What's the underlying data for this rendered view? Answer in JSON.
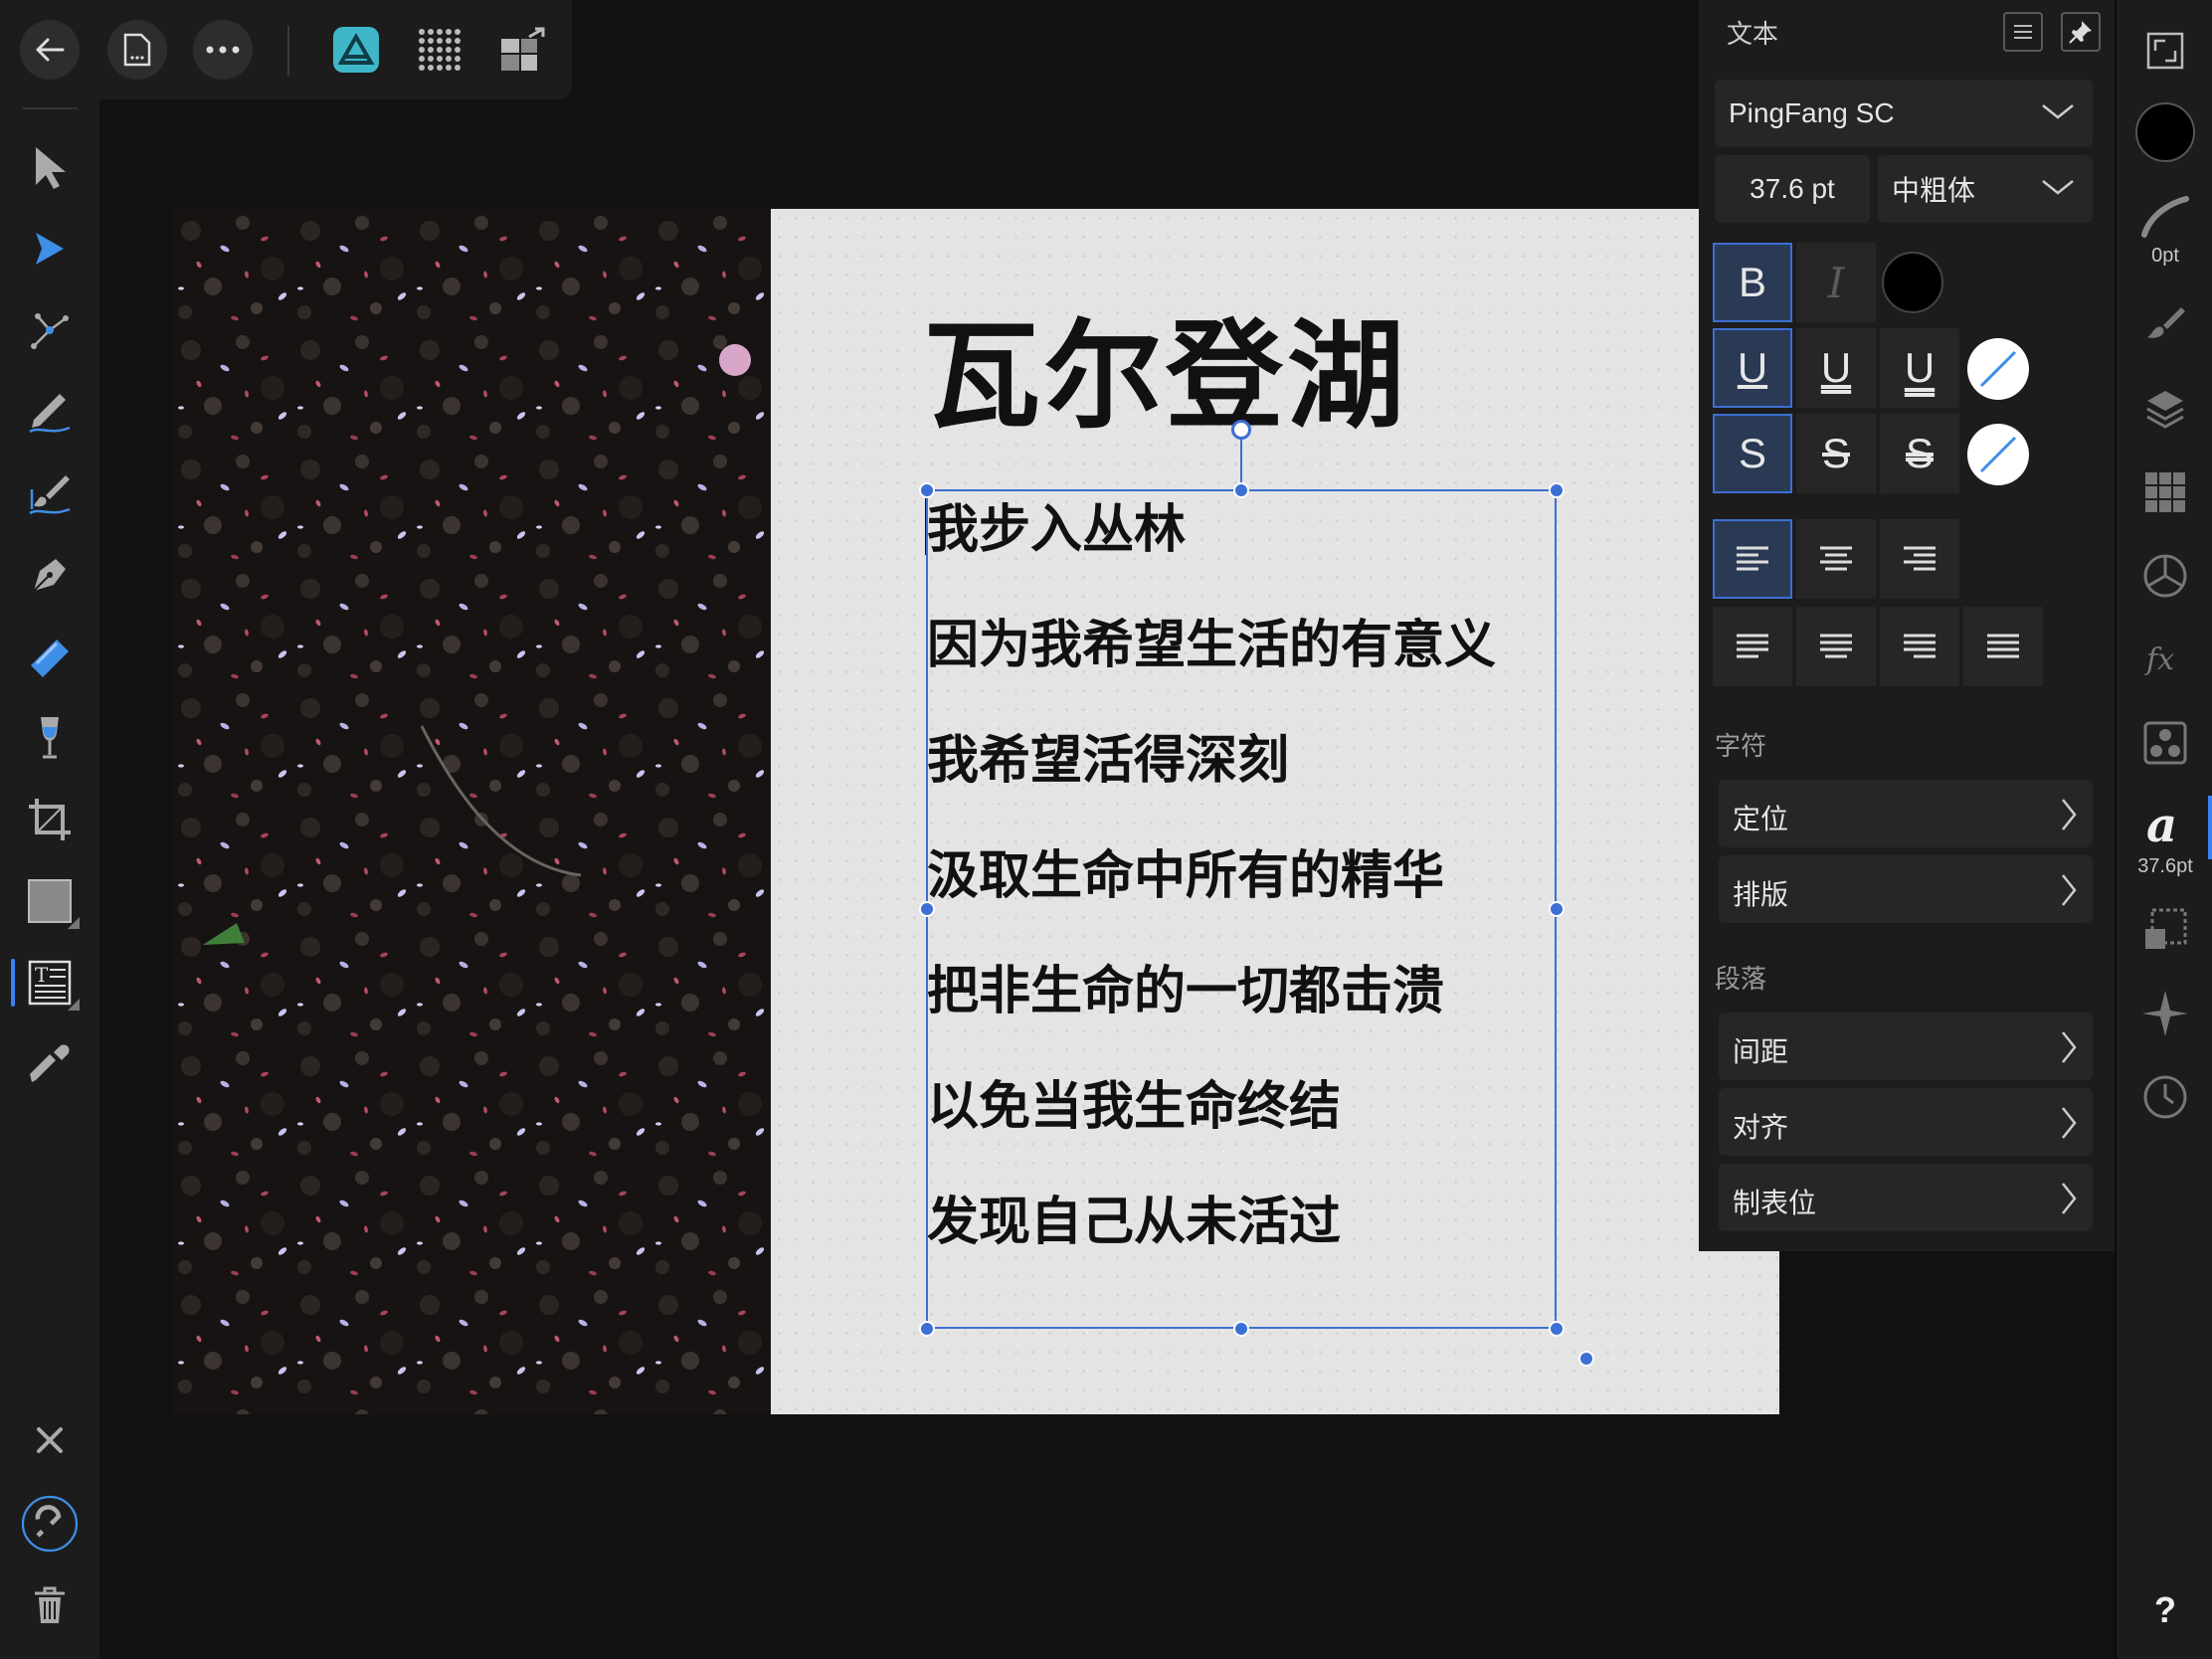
{
  "toolbar": {
    "buttons": [
      "back-icon",
      "document-icon",
      "more-icon"
    ],
    "personas": [
      "designer-persona-icon",
      "pixel-persona-icon",
      "export-persona-icon"
    ]
  },
  "tools": [
    "move-tool",
    "node-tool",
    "point-transform-tool",
    "pencil-tool",
    "vector-brush-tool",
    "pen-tool",
    "fill-tool",
    "transparency-tool",
    "crop-tool",
    "rectangle-tool",
    "artistic-text-tool",
    "color-picker-tool"
  ],
  "canvas": {
    "title": "瓦尔登湖",
    "lines": [
      "我步入丛林",
      "因为我希望生活的有意义",
      "我希望活得深刻",
      "汲取生命中所有的精华",
      "把非生命的一切都击溃",
      "以免当我生命终结",
      "发现自己从未活过"
    ]
  },
  "text_panel": {
    "title": "文本",
    "font_family": "PingFang SC",
    "font_size": "37.6 pt",
    "font_weight": "中粗体",
    "bold": "B",
    "italic": "I",
    "underline": [
      "U",
      "U",
      "U"
    ],
    "strike": [
      "S",
      "S",
      "S"
    ],
    "text_color": "#000000",
    "section_character": "字符",
    "character_rows": [
      "定位",
      "排版"
    ],
    "section_paragraph": "段落",
    "paragraph_rows": [
      "间距",
      "对齐",
      "制表位"
    ]
  },
  "right_bar": {
    "stroke_width": "0pt",
    "font_size_badge": "37.6pt",
    "help": "?"
  },
  "colors": {
    "accent": "#3b6fd3",
    "panel_bg": "#1c1c1c",
    "canvas_bg": "#111111"
  }
}
